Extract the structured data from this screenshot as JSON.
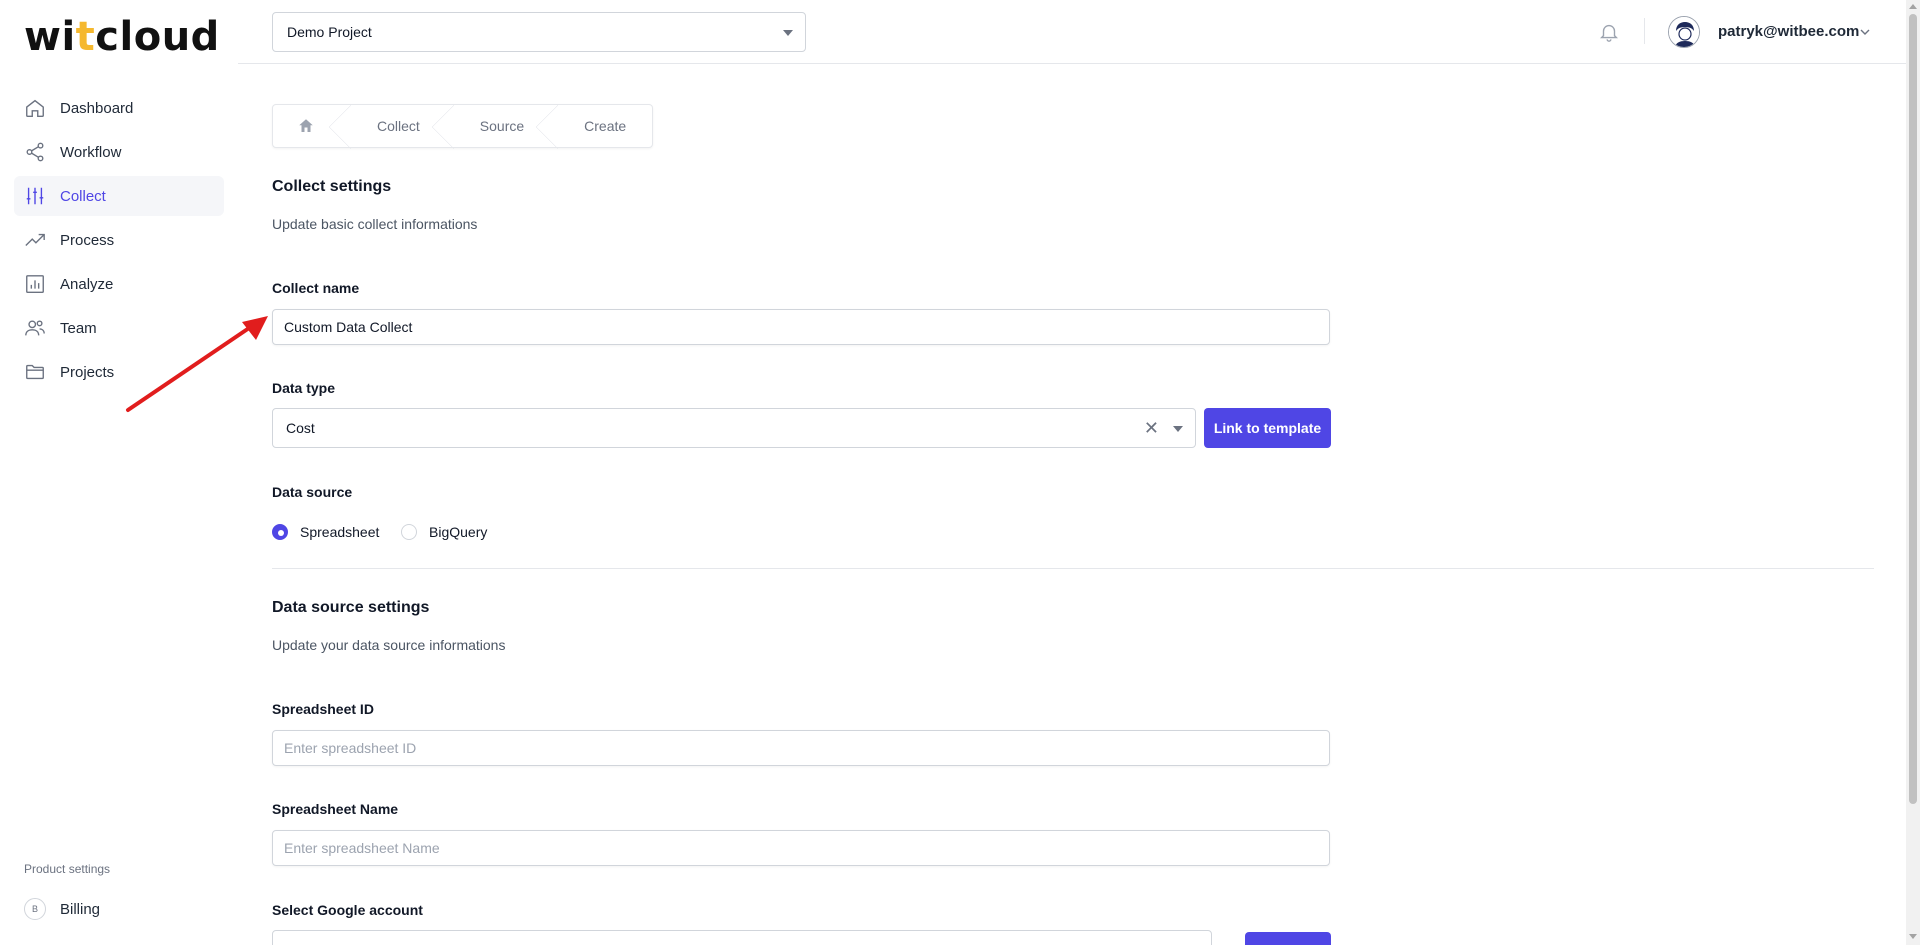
{
  "brand": {
    "logo_pre": "wi",
    "logo_accent": "t",
    "logo_post": "cloud"
  },
  "sidebar": {
    "items": [
      {
        "label": "Dashboard",
        "icon": "home-icon"
      },
      {
        "label": "Workflow",
        "icon": "share-icon"
      },
      {
        "label": "Collect",
        "icon": "sliders-icon",
        "active": true
      },
      {
        "label": "Process",
        "icon": "trending-up-icon"
      },
      {
        "label": "Analyze",
        "icon": "bar-chart-icon"
      },
      {
        "label": "Team",
        "icon": "users-icon"
      },
      {
        "label": "Projects",
        "icon": "folder-icon"
      }
    ],
    "product_settings_label": "Product settings",
    "billing": {
      "badge": "B",
      "label": "Billing"
    }
  },
  "header": {
    "project_select": "Demo Project",
    "user_email": "patryk@witbee.com"
  },
  "breadcrumb": {
    "items": [
      "Collect",
      "Source",
      "Create"
    ]
  },
  "collect_settings": {
    "title": "Collect settings",
    "description": "Update basic collect informations",
    "name_label": "Collect name",
    "name_value": "Custom Data Collect",
    "data_type_label": "Data type",
    "data_type_value": "Cost",
    "link_template_button": "Link to template",
    "data_source_label": "Data source",
    "data_source_options": [
      {
        "label": "Spreadsheet",
        "checked": true
      },
      {
        "label": "BigQuery",
        "checked": false
      }
    ]
  },
  "data_source_settings": {
    "title": "Data source settings",
    "description": "Update your data source informations",
    "spreadsheet_id_label": "Spreadsheet ID",
    "spreadsheet_id_placeholder": "Enter spreadsheet ID",
    "spreadsheet_name_label": "Spreadsheet Name",
    "spreadsheet_name_placeholder": "Enter spreadsheet Name",
    "google_account_label": "Select Google account"
  },
  "colors": {
    "accent": "#4f46e5",
    "logo_accent": "#f5b82e",
    "annotation_arrow": "#e11d1d"
  }
}
